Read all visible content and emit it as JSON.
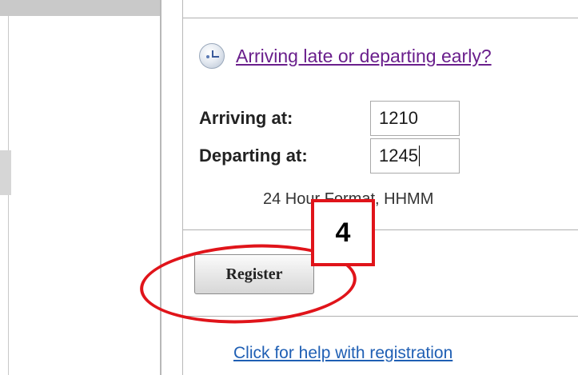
{
  "late_link": "Arriving late or departing early?",
  "arriving": {
    "label": "Arriving at:",
    "value": "1210"
  },
  "departing": {
    "label": "Departing at:",
    "value": "1245"
  },
  "format_hint": "24 Hour Format, HHMM",
  "register_button": "Register",
  "help_link": "Click for help with registration",
  "annotation": {
    "step": "4",
    "color": "#e0141a"
  },
  "icons": {
    "late": "clock-icon"
  }
}
